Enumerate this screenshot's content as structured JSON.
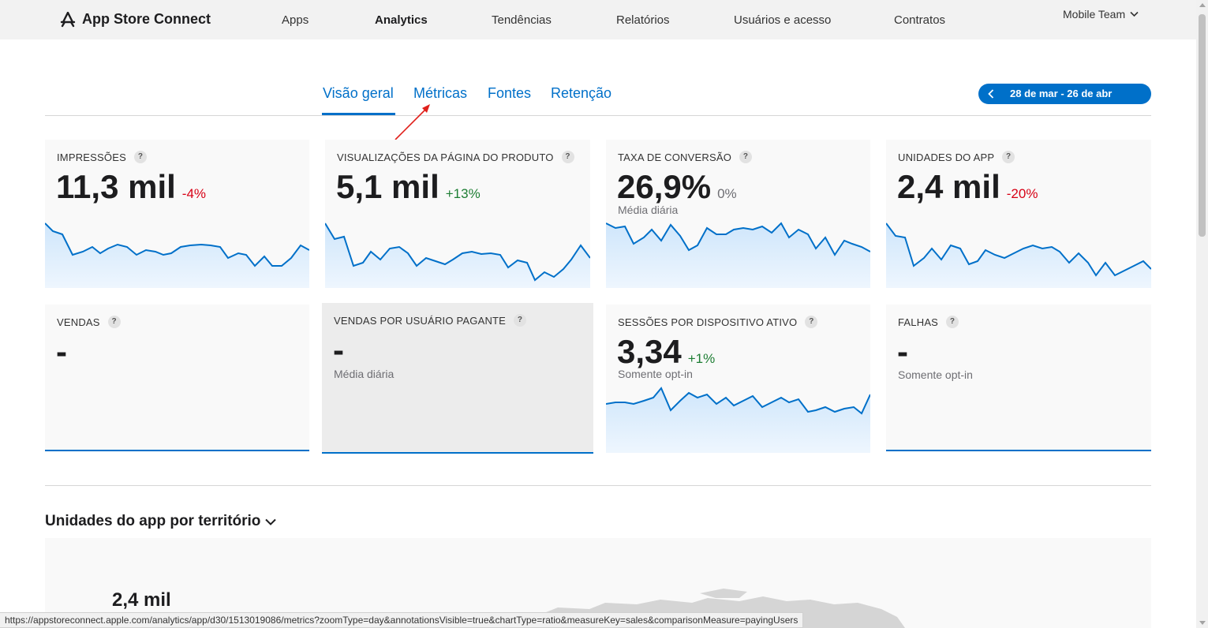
{
  "header": {
    "brand": "App Store Connect",
    "nav": [
      "Apps",
      "Analytics",
      "Tendências",
      "Relatórios",
      "Usuários e acesso",
      "Contratos"
    ],
    "team": "Mobile Team"
  },
  "tabs": [
    "Visão geral",
    "Métricas",
    "Fontes",
    "Retenção"
  ],
  "date_range": "28 de mar - 26 de abr",
  "cards": [
    {
      "title": "IMPRESSÕES",
      "value": "11,3 mil",
      "delta": "-4%",
      "sub": ""
    },
    {
      "title": "VISUALIZAÇÕES DA PÁGINA DO PRODUTO",
      "value": "5,1 mil",
      "delta": "+13%",
      "sub": ""
    },
    {
      "title": "TAXA DE CONVERSÃO",
      "value": "26,9%",
      "delta": "0%",
      "sub": "Média diária"
    },
    {
      "title": "UNIDADES DO APP",
      "value": "2,4 mil",
      "delta": "-20%",
      "sub": ""
    },
    {
      "title": "VENDAS",
      "value": "-",
      "delta": "",
      "sub": ""
    },
    {
      "title": "VENDAS POR USUÁRIO PAGANTE",
      "value": "-",
      "delta": "",
      "sub": "Média diária"
    },
    {
      "title": "SESSÕES POR DISPOSITIVO ATIVO",
      "value": "3,34",
      "delta": "+1%",
      "sub": "Somente opt-in"
    },
    {
      "title": "FALHAS",
      "value": "-",
      "delta": "",
      "sub": "Somente opt-in"
    }
  ],
  "help_glyph": "?",
  "section": {
    "title": "Unidades do app por território",
    "value": "2,4 mil"
  },
  "status_url": "https://appstoreconnect.apple.com/analytics/app/d30/1513019086/metrics?zoomType=day&annotationsVisible=true&chartType=ratio&measureKey=sales&comparisonMeasure=payingUsers",
  "colors": {
    "accent": "#0070c9",
    "negative": "#d70015",
    "positive": "#1e7e34",
    "annotation": "#e0201b"
  },
  "icons": [
    "app-store-icon",
    "chevron-down-icon",
    "chevron-left-icon",
    "help-icon",
    "arrow-icon",
    "world-map"
  ]
}
